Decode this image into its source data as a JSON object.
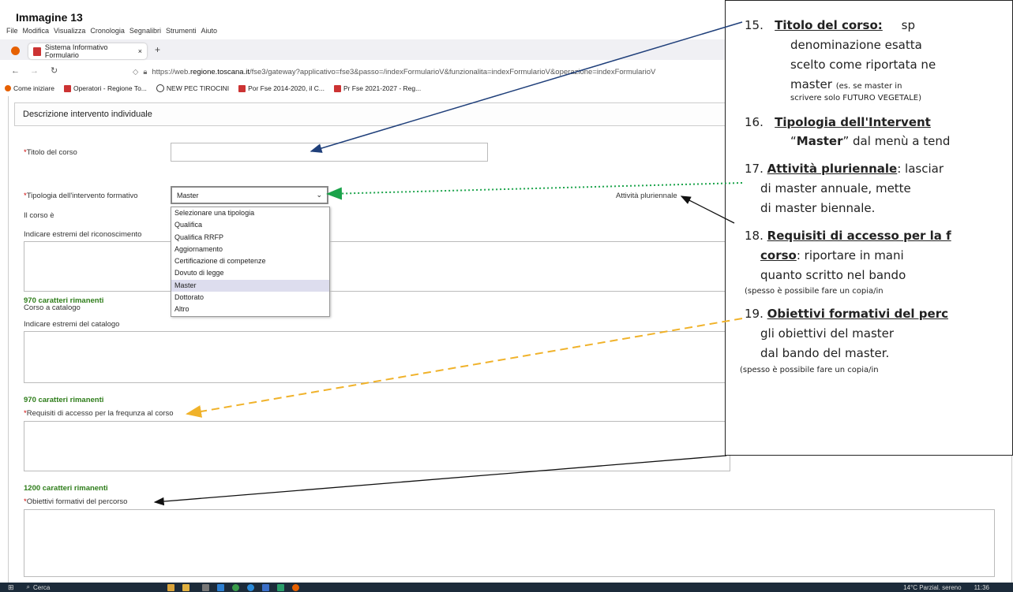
{
  "caption": "Immagine 13",
  "menu": [
    "File",
    "Modifica",
    "Visualizza",
    "Cronologia",
    "Segnalibri",
    "Strumenti",
    "Aiuto"
  ],
  "tab": {
    "title": "Sistema Informativo Formulario",
    "close": "×",
    "new": "+"
  },
  "url": {
    "prefix": "https://web.",
    "domain": "regione.toscana.it",
    "rest": "/fse3/gateway?applicativo=fse3&passo=/indexFormularioV&funzionalita=indexFormularioV&operazione=indexFormularioV"
  },
  "bookmarks": [
    "Come iniziare",
    "Operatori - Regione To...",
    "NEW PEC TIROCINI",
    "Por Fse 2014-2020, il C...",
    "Pr Fse 2021-2027 - Reg..."
  ],
  "form": {
    "panel_title": "Descrizione intervento individuale",
    "titolo_label": "Titolo del corso",
    "tipologia_label": "Tipologia dell'intervento formativo",
    "tipologia_value": "Master",
    "pluriennale_label": "Attività pluriennale",
    "corso_e_label": "Il corso è",
    "estremi_label": "Indicare estremi del riconoscimento",
    "count1": "970 caratteri rimanenti",
    "catalogo_label": "Corso a catalogo",
    "estremi_catalogo_label": "Indicare estremi del catalogo",
    "count2": "970 caratteri rimanenti",
    "requisiti_label": "Requisiti di accesso per la frequnza al corso",
    "count3": "1200 caratteri rimanenti",
    "obiettivi_label": "Obiettivi formativi del percorso",
    "options": [
      "Selezionare una tipologia",
      "Qualifica",
      "Qualifica RRFP",
      "Aggiornamento",
      "Certificazione di competenze",
      "Dovuto di legge",
      "Master",
      "Dottorato",
      "Altro"
    ],
    "selected_option": "Master"
  },
  "notes": {
    "n15_num": "15.",
    "n15_title": "Titolo del corso:",
    "n15_l1": "sp",
    "n15_l2": "denominazione esatta",
    "n15_l3": "scelto come riportata ne",
    "n15_l4": "master",
    "n15_l4s": "(es. se master in",
    "n15_l5": "scrivere solo FUTURO VEGETALE)",
    "n16_num": "16.",
    "n16_title": "Tipologia dell'Intervent",
    "n16_l2a": "“",
    "n16_l2b": "Master",
    "n16_l2c": "” dal menù a tend",
    "n17_num": "17.",
    "n17_title": "Attività pluriennale",
    "n17_l1": ": lasciar",
    "n17_l2": "di master annuale, mette",
    "n17_l3": "di master biennale.",
    "n18_num": "18.",
    "n18_title": "Requisiti di accesso per la f",
    "n18_l2a": "corso",
    "n18_l2b": ": riportare in mani",
    "n18_l3": "quanto scritto nel bando",
    "n18_l4": "(spesso è possibile fare un copia/in",
    "n19_num": "19.",
    "n19_title": "Obiettivi formativi del perc",
    "n19_l2": "gli obiettivi del master",
    "n19_l3": "dal bando del master.",
    "n19_l4": "(spesso è possibile fare un copia/in"
  },
  "taskbar": {
    "search": "Cerca",
    "weather": "14°C Parzial. sereno",
    "time": "11:36"
  },
  "colors": {
    "green_count": "#2e7d1a",
    "arrow_blue": "#1f3f7a",
    "arrow_green": "#1aa34a",
    "arrow_orange": "#f0b22a",
    "taskbar": "#1c2b3a"
  }
}
